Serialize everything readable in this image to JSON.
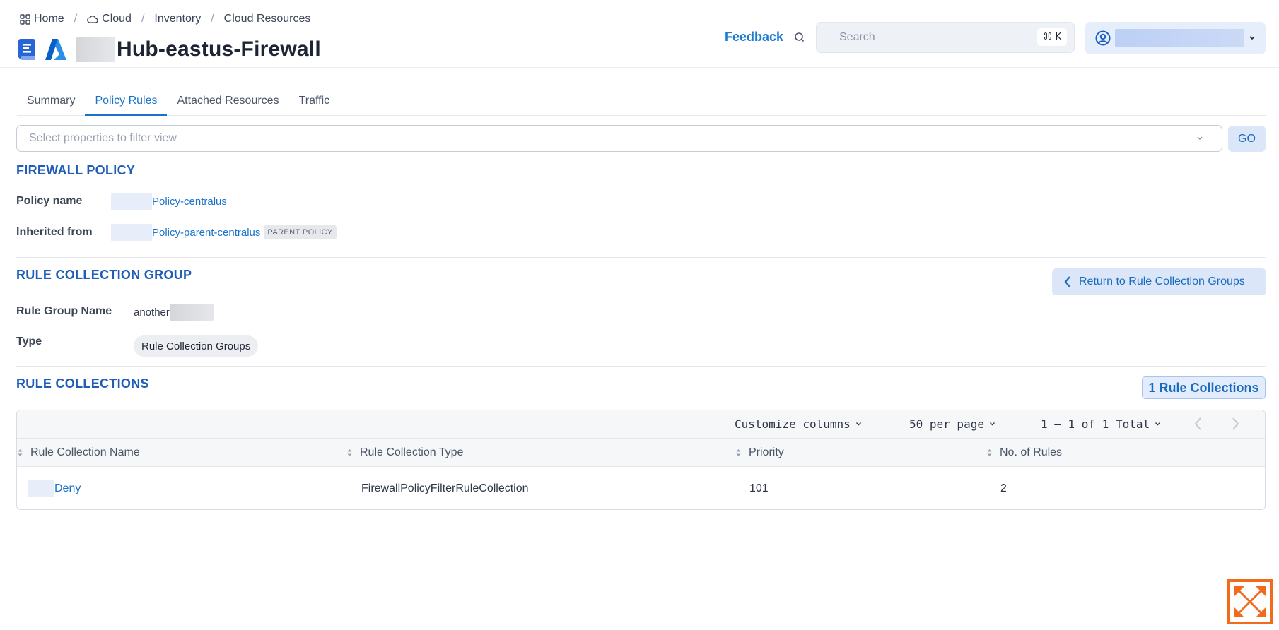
{
  "breadcrumb": {
    "home": "Home",
    "cloud": "Cloud",
    "inventory": "Inventory",
    "current": "Cloud Resources",
    "separator": "/"
  },
  "header": {
    "title": "Hub-eastus-Firewall",
    "feedback": "Feedback",
    "search_placeholder": "Search",
    "search_shortcut": "⌘ K"
  },
  "tabs": [
    "Summary",
    "Policy Rules",
    "Attached Resources",
    "Traffic"
  ],
  "active_tab": "Policy Rules",
  "filter": {
    "placeholder": "Select properties to filter view",
    "go": "GO"
  },
  "firewall_policy": {
    "heading": "FIREWALL POLICY",
    "policy_name_label": "Policy name",
    "policy_name_value": "Policy-centralus",
    "inherited_label": "Inherited from",
    "inherited_value": "Policy-parent-centralus",
    "inherited_badge": "PARENT POLICY"
  },
  "rule_collection_group": {
    "heading": "RULE COLLECTION GROUP",
    "return_button": "Return to Rule Collection Groups",
    "name_label": "Rule Group Name",
    "name_value": "another",
    "type_label": "Type",
    "type_value": "Rule Collection Groups"
  },
  "rule_collections": {
    "heading": "RULE COLLECTIONS",
    "count_button": "1 Rule Collections",
    "toolbar": {
      "customize": "Customize columns",
      "per_page": "50 per page",
      "range": "1 – 1 of 1 Total"
    },
    "columns": [
      "Rule Collection Name",
      "Rule Collection Type",
      "Priority",
      "No. of Rules"
    ],
    "rows": [
      {
        "name": "Deny",
        "type": "FirewallPolicyFilterRuleCollection",
        "priority": "101",
        "rules": "2"
      }
    ]
  },
  "colors": {
    "accent": "#1a73c9",
    "section_heading": "#1f5db7",
    "button_bg": "#dbe7f8",
    "logo_orange": "#f26b1d"
  }
}
